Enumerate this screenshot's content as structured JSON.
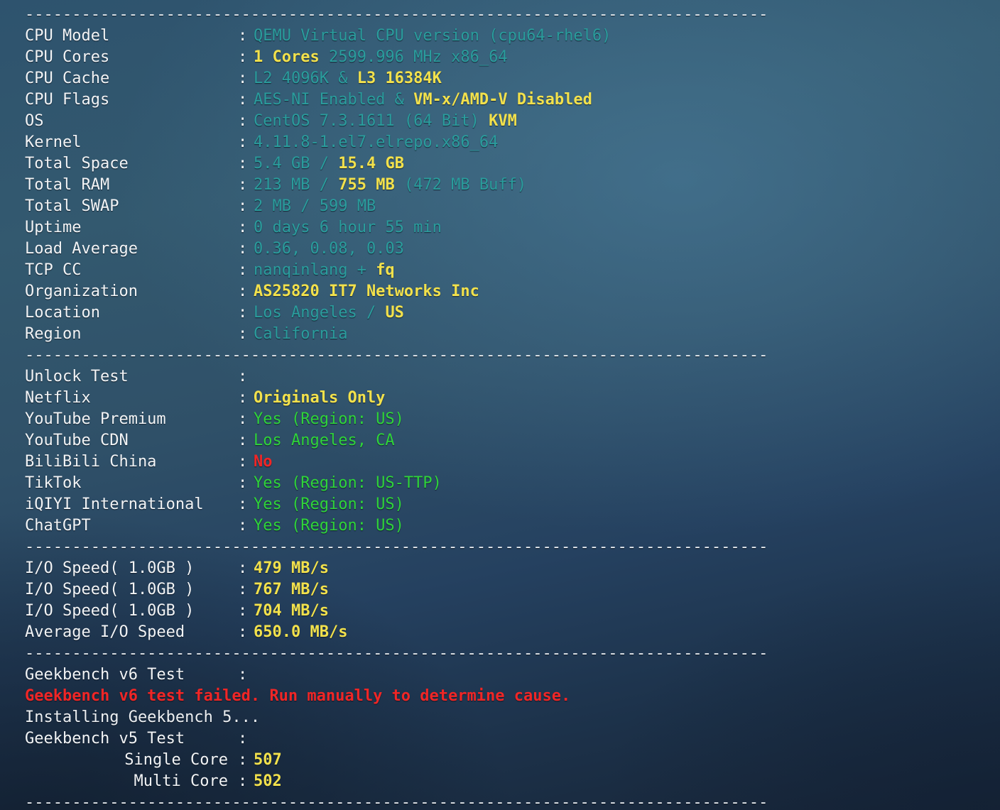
{
  "terminal": {
    "app": "bench.sh system benchmark output",
    "separator": "-------------------------------------------------------------------------------",
    "clipped_top_row": "                                                                               "
  },
  "sections": {
    "system": {
      "rows": [
        {
          "label": "CPU Model",
          "parts": [
            {
              "text": "QEMU Virtual CPU version (cpu64-rhel6)",
              "color": "cyan"
            }
          ]
        },
        {
          "label": "CPU Cores",
          "parts": [
            {
              "text": "1 Cores",
              "color": "yellow"
            },
            {
              "text": " 2599.996 MHz x86_64",
              "color": "cyan"
            }
          ]
        },
        {
          "label": "CPU Cache",
          "parts": [
            {
              "text": "L2 4096K & ",
              "color": "cyan"
            },
            {
              "text": "L3 16384K",
              "color": "yellow"
            }
          ]
        },
        {
          "label": "CPU Flags",
          "parts": [
            {
              "text": "AES-NI Enabled & ",
              "color": "cyan"
            },
            {
              "text": "VM-x/AMD-V Disabled",
              "color": "yellow"
            }
          ]
        },
        {
          "label": "OS",
          "parts": [
            {
              "text": "CentOS 7.3.1611 (64 Bit) ",
              "color": "cyan"
            },
            {
              "text": "KVM",
              "color": "yellow"
            }
          ]
        },
        {
          "label": "Kernel",
          "parts": [
            {
              "text": "4.11.8-1.el7.elrepo.x86_64",
              "color": "cyan"
            }
          ]
        },
        {
          "label": "Total Space",
          "parts": [
            {
              "text": "5.4 GB / ",
              "color": "cyan"
            },
            {
              "text": "15.4 GB",
              "color": "yellow"
            }
          ]
        },
        {
          "label": "Total RAM",
          "parts": [
            {
              "text": "213 MB / ",
              "color": "cyan"
            },
            {
              "text": "755 MB",
              "color": "yellow"
            },
            {
              "text": " (472 MB Buff)",
              "color": "cyan"
            }
          ]
        },
        {
          "label": "Total SWAP",
          "parts": [
            {
              "text": "2 MB / 599 MB",
              "color": "cyan"
            }
          ]
        },
        {
          "label": "Uptime",
          "parts": [
            {
              "text": "0 days 6 hour 55 min",
              "color": "cyan"
            }
          ]
        },
        {
          "label": "Load Average",
          "parts": [
            {
              "text": "0.36, 0.08, 0.03",
              "color": "cyan"
            }
          ]
        },
        {
          "label": "TCP CC",
          "parts": [
            {
              "text": "nanqinlang + ",
              "color": "cyan"
            },
            {
              "text": "fq",
              "color": "yellow"
            }
          ]
        },
        {
          "label": "Organization",
          "parts": [
            {
              "text": "AS25820 IT7 Networks Inc",
              "color": "yellow"
            }
          ]
        },
        {
          "label": "Location",
          "parts": [
            {
              "text": "Los Angeles / ",
              "color": "cyan"
            },
            {
              "text": "US",
              "color": "yellow"
            }
          ]
        },
        {
          "label": "Region",
          "parts": [
            {
              "text": "California",
              "color": "cyan"
            }
          ]
        }
      ]
    },
    "unlock": {
      "rows": [
        {
          "label": "Unlock Test",
          "parts": []
        },
        {
          "label": "Netflix",
          "parts": [
            {
              "text": "Originals Only",
              "color": "yellow"
            }
          ]
        },
        {
          "label": "YouTube Premium",
          "parts": [
            {
              "text": "Yes (Region: US)",
              "color": "green"
            }
          ]
        },
        {
          "label": "YouTube CDN",
          "parts": [
            {
              "text": "Los Angeles, CA",
              "color": "green"
            }
          ]
        },
        {
          "label": "BiliBili China",
          "parts": [
            {
              "text": "No",
              "color": "red"
            }
          ]
        },
        {
          "label": "TikTok",
          "parts": [
            {
              "text": "Yes (Region: US-TTP)",
              "color": "green"
            }
          ]
        },
        {
          "label": "iQIYI International",
          "parts": [
            {
              "text": "Yes (Region: US)",
              "color": "green"
            }
          ]
        },
        {
          "label": "ChatGPT",
          "parts": [
            {
              "text": "Yes (Region: US)",
              "color": "green"
            }
          ]
        }
      ]
    },
    "io": {
      "rows": [
        {
          "label": "I/O Speed( 1.0GB )",
          "parts": [
            {
              "text": "479 MB/s",
              "color": "yellow"
            }
          ]
        },
        {
          "label": "I/O Speed( 1.0GB )",
          "parts": [
            {
              "text": "767 MB/s",
              "color": "yellow"
            }
          ]
        },
        {
          "label": "I/O Speed( 1.0GB )",
          "parts": [
            {
              "text": "704 MB/s",
              "color": "yellow"
            }
          ]
        },
        {
          "label": "Average I/O Speed",
          "parts": [
            {
              "text": "650.0 MB/s",
              "color": "yellow"
            }
          ]
        }
      ]
    },
    "geekbench": {
      "v6_label": "Geekbench v6 Test",
      "v6_error": "Geekbench v6 test failed. Run manually to determine cause.",
      "installing": "Installing Geekbench 5...",
      "v5_label": "Geekbench v5 Test",
      "scores": [
        {
          "label": "Single Core",
          "parts": [
            {
              "text": "507",
              "color": "yellow"
            }
          ]
        },
        {
          "label": "Multi Core",
          "parts": [
            {
              "text": "502",
              "color": "yellow"
            }
          ]
        }
      ]
    }
  },
  "colors": {
    "background_light": "#33596f",
    "background_dark": "#172436",
    "value_cyan": "#2a9d9d",
    "value_yellow": "#f2e14c",
    "value_green": "#2fd43a",
    "value_red": "#f02626",
    "label_white": "#f2f4f6"
  }
}
